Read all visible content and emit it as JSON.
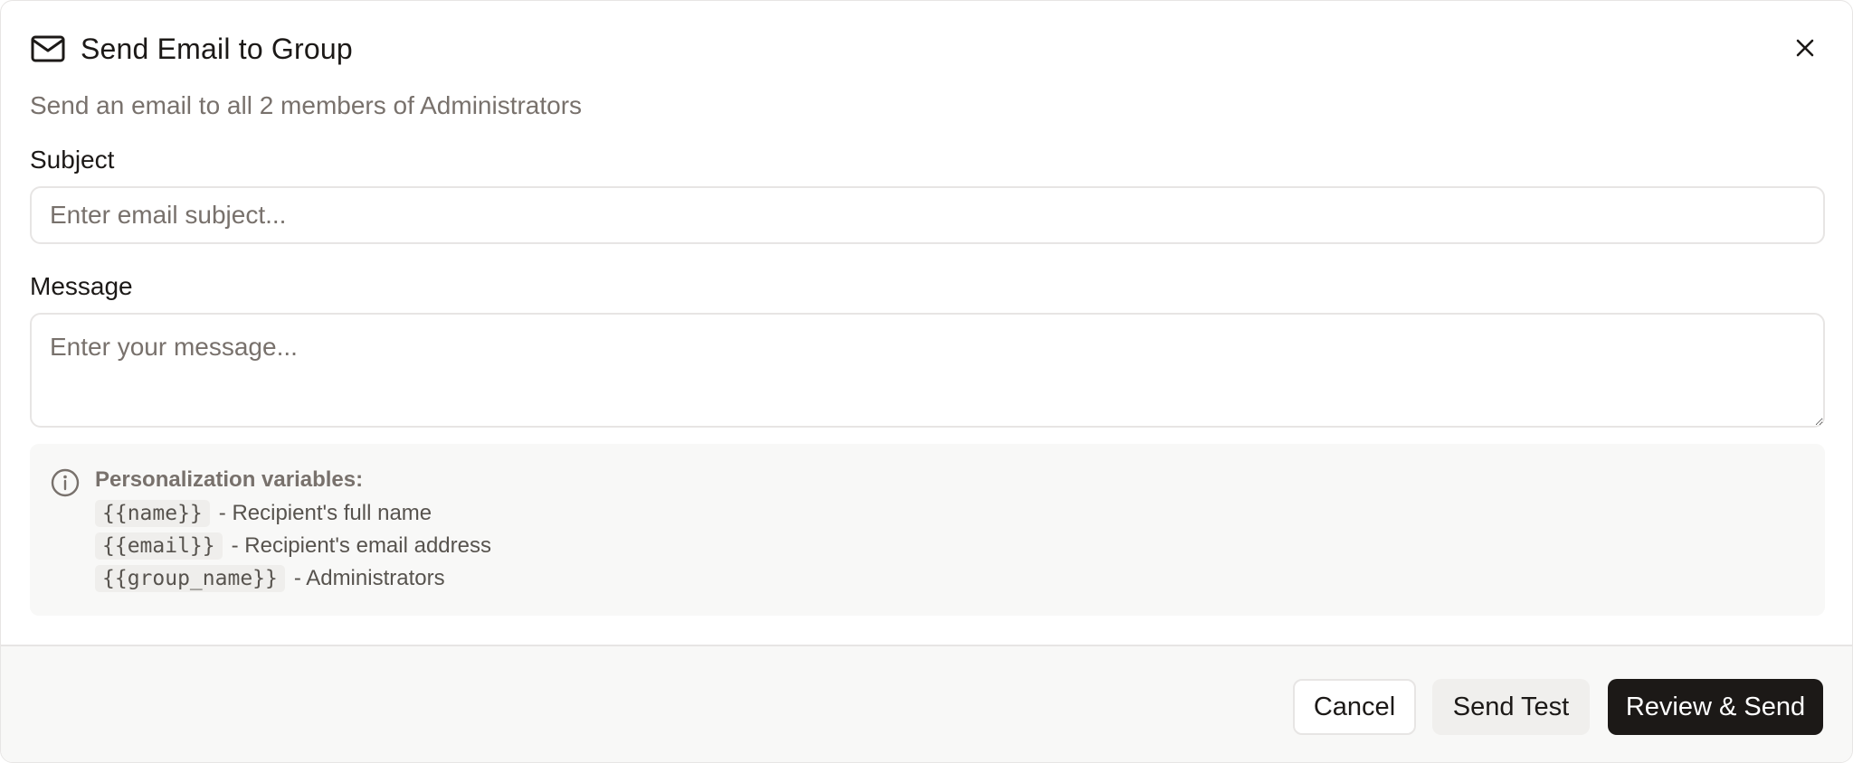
{
  "dialog": {
    "title": "Send Email to Group",
    "subtitle": "Send an email to all 2 members of Administrators",
    "icon": "mail-icon",
    "close_icon": "close-icon"
  },
  "form": {
    "subject_label": "Subject",
    "subject_value": "",
    "subject_placeholder": "Enter email subject...",
    "message_label": "Message",
    "message_value": "",
    "message_placeholder": "Enter your message..."
  },
  "variables": {
    "icon": "info-icon",
    "title": "Personalization variables:",
    "items": [
      {
        "code": "{{name}}",
        "description": "- Recipient's full name"
      },
      {
        "code": "{{email}}",
        "description": "- Recipient's email address"
      },
      {
        "code": "{{group_name}}",
        "description": "- Administrators"
      }
    ]
  },
  "footer": {
    "cancel_label": "Cancel",
    "test_label": "Send Test",
    "send_label": "Review & Send"
  },
  "colors": {
    "primary_button": "#1c1917",
    "muted_text": "#78716c",
    "border": "#e7e5e4",
    "panel_bg": "#f8f8f7"
  }
}
